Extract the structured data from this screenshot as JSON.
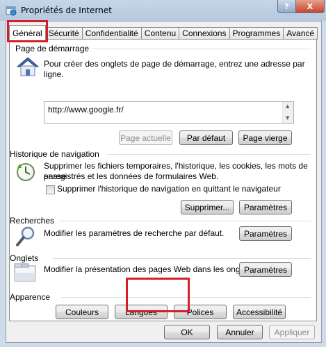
{
  "window": {
    "title": "Propriétés de Internet",
    "help_label": "?",
    "close_label": "X"
  },
  "tabs": [
    {
      "label": "Général",
      "active": true
    },
    {
      "label": "Sécurité"
    },
    {
      "label": "Confidentialité"
    },
    {
      "label": "Contenu"
    },
    {
      "label": "Connexions"
    },
    {
      "label": "Programmes"
    },
    {
      "label": "Avancé"
    }
  ],
  "startup": {
    "title": "Page de démarrage",
    "description": "Pour créer des onglets de page de démarrage, entrez une adresse par ligne.",
    "url": "http://www.google.fr/",
    "buttons": {
      "current": "Page actuelle",
      "default": "Par défaut",
      "blank": "Page vierge"
    }
  },
  "history": {
    "title": "Historique de navigation",
    "description_line1": "Supprimer les fichiers temporaires, l'historique, les cookies, les mots de passe",
    "description_line2": "enregistrés et les données de formulaires Web.",
    "checkbox_label": "Supprimer l'historique de navigation en quittant le navigateur",
    "checkbox_checked": false,
    "buttons": {
      "delete": "Supprimer...",
      "settings": "Paramètres"
    }
  },
  "search": {
    "title": "Recherches",
    "description": "Modifier les paramètres de recherche par défaut.",
    "settings_label": "Paramètres"
  },
  "tabs_section": {
    "title": "Onglets",
    "description": "Modifier la présentation des pages Web dans les onglets.",
    "settings_label": "Paramètres"
  },
  "appearance": {
    "title": "Apparence",
    "buttons": {
      "colors": "Couleurs",
      "languages": "Langues",
      "fonts": "Polices",
      "accessibility": "Accessibilité"
    }
  },
  "footer": {
    "ok": "OK",
    "cancel": "Annuler",
    "apply": "Appliquer"
  },
  "highlight_color": "#d41f2a"
}
